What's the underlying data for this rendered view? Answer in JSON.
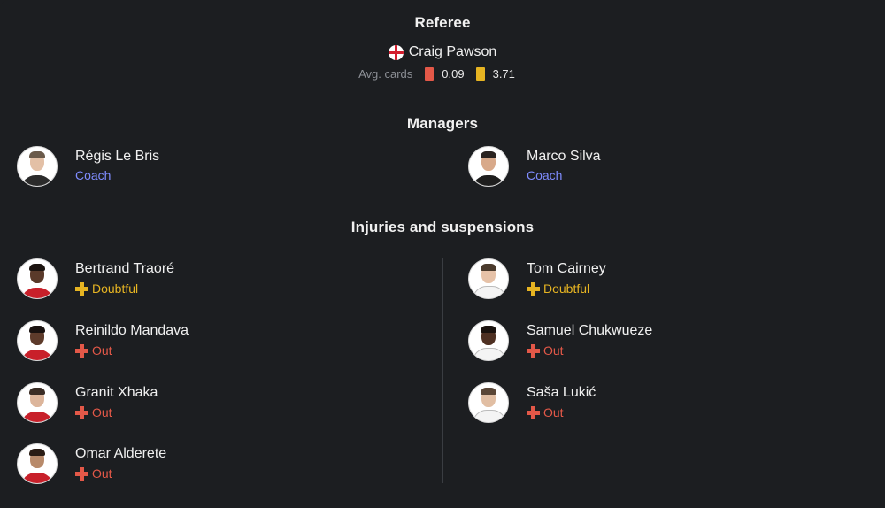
{
  "referee": {
    "title": "Referee",
    "name": "Craig Pawson",
    "avg_label": "Avg. cards",
    "red_value": "0.09",
    "yellow_value": "3.71"
  },
  "managers": {
    "title": "Managers",
    "left": {
      "name": "Régis Le Bris",
      "role": "Coach"
    },
    "right": {
      "name": "Marco Silva",
      "role": "Coach"
    }
  },
  "injuries": {
    "title": "Injuries and suspensions",
    "left": [
      {
        "name": "Bertrand Traoré",
        "status": "Doubtful"
      },
      {
        "name": "Reinildo Mandava",
        "status": "Out"
      },
      {
        "name": "Granit Xhaka",
        "status": "Out"
      },
      {
        "name": "Omar Alderete",
        "status": "Out"
      }
    ],
    "right": [
      {
        "name": "Tom Cairney",
        "status": "Doubtful"
      },
      {
        "name": "Samuel Chukwueze",
        "status": "Out"
      },
      {
        "name": "Saša Lukić",
        "status": "Out"
      }
    ]
  },
  "colors": {
    "background": "#1c1e21",
    "coach": "#7f8cff",
    "doubtful": "#e6b422",
    "out": "#e35848",
    "red_card": "#e35848",
    "yellow_card": "#e6b422"
  },
  "icons": {
    "flag": "england-flag-icon",
    "red_card": "red-card-icon",
    "yellow_card": "yellow-card-icon",
    "doubtful": "plus-doubtful-icon",
    "out": "plus-out-icon"
  }
}
